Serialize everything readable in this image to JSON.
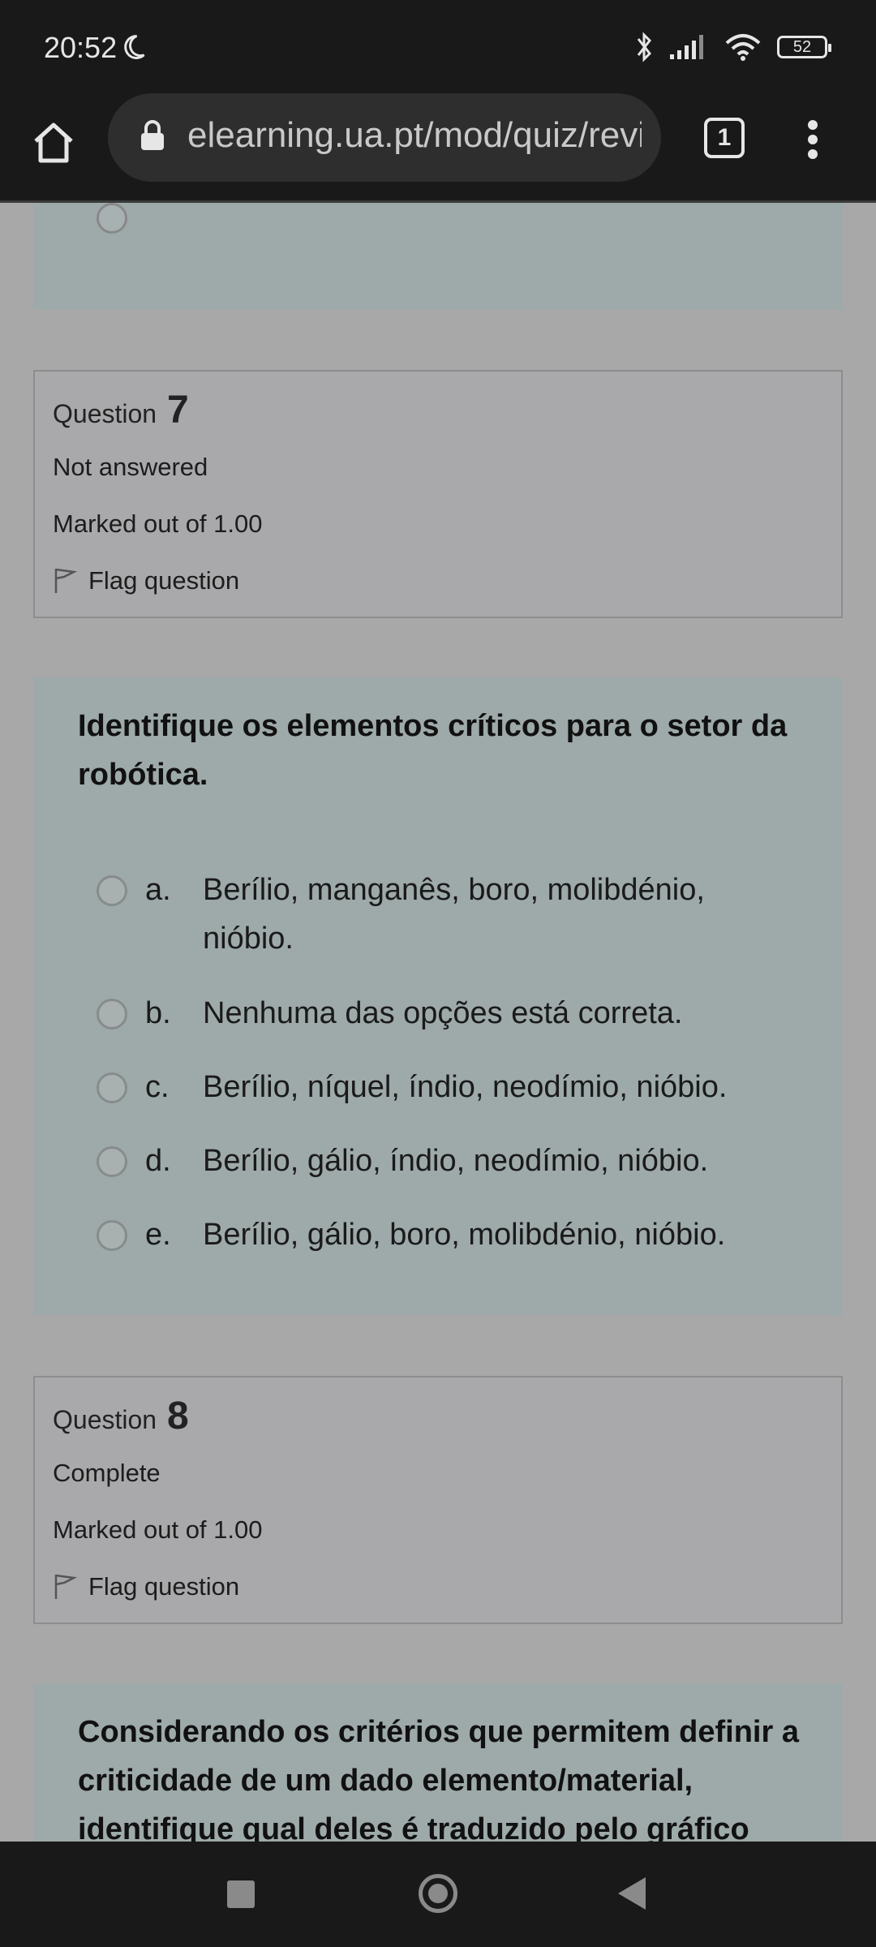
{
  "status_bar": {
    "time": "20:52",
    "battery": "52",
    "icons": [
      "moon-icon",
      "bluetooth-icon",
      "signal-icon",
      "wifi-icon",
      "battery-icon"
    ]
  },
  "browser": {
    "url": "elearning.ua.pt/mod/quiz/review.php",
    "tab_count": "1"
  },
  "questions": [
    {
      "label": "Question",
      "number": "7",
      "status": "Not answered",
      "marked": "Marked out of 1.00",
      "flag": "Flag question",
      "text": "Identifique os elementos críticos para o setor da robótica.",
      "options": [
        {
          "letter": "a.",
          "text": "Berílio, manganês, boro, molibdénio, nióbio."
        },
        {
          "letter": "b.",
          "text": "Nenhuma das opções está correta."
        },
        {
          "letter": "c.",
          "text": "Berílio, níquel, índio, neodímio, nióbio."
        },
        {
          "letter": "d.",
          "text": "Berílio, gálio, índio, neodímio, nióbio."
        },
        {
          "letter": "e.",
          "text": "Berílio, gálio, boro, molibdénio, nióbio."
        }
      ]
    },
    {
      "label": "Question",
      "number": "8",
      "status": "Complete",
      "marked": "Marked out of 1.00",
      "flag": "Flag question",
      "text": "Considerando os critérios que permitem definir a criticidade de um dado elemento/material, identifique qual deles é traduzido pelo gráfico"
    }
  ],
  "colors": {
    "page_bg": "#a8a8a8",
    "question_bg": "#9ea9a9",
    "bar_bg": "#191919"
  }
}
